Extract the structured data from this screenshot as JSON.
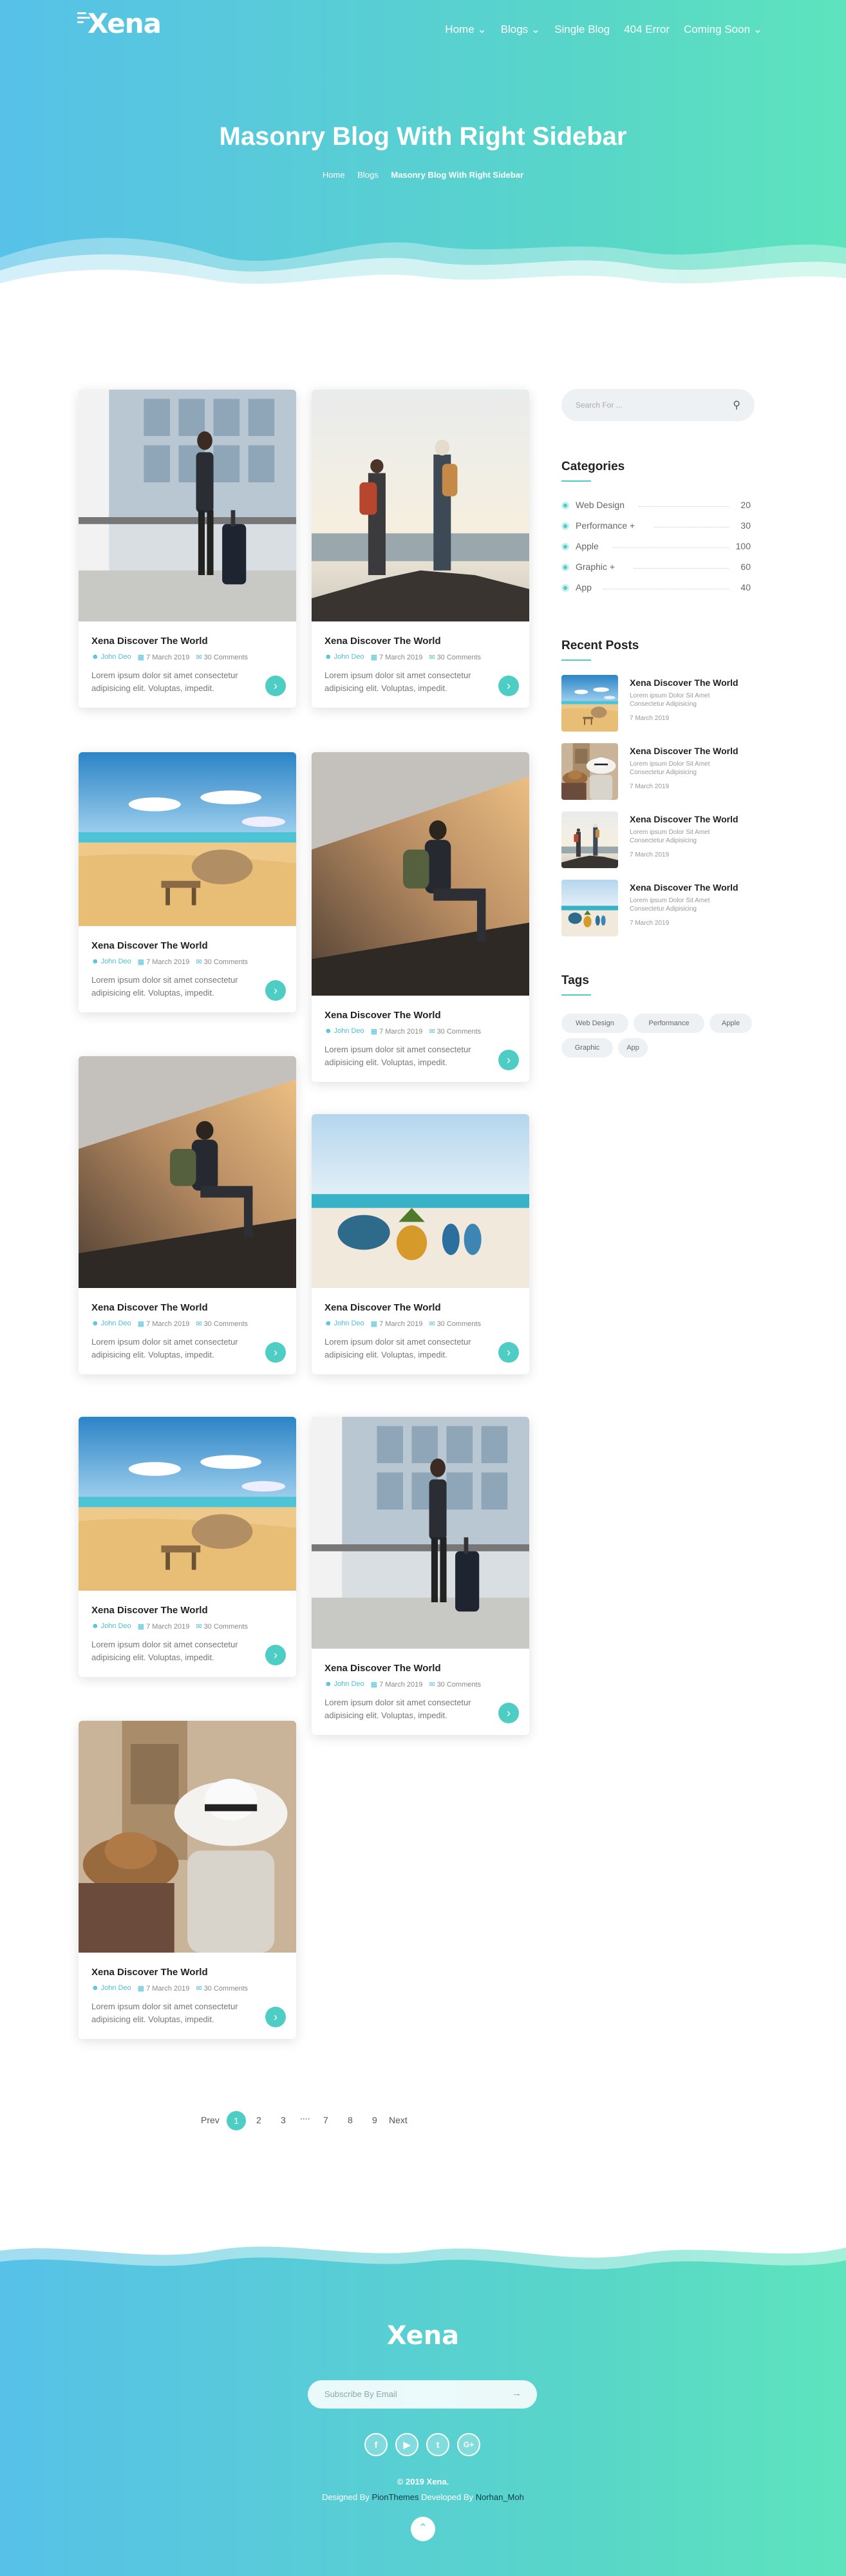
{
  "brand": "Xena",
  "nav": [
    "Home ⌄",
    "Blogs ⌄",
    "Single Blog",
    "404 Error",
    "Coming Soon ⌄"
  ],
  "hero": {
    "title": "Masonry Blog With Right Sidebar",
    "crumbs": [
      "Home",
      "Blogs",
      "Masonry Blog With Right Sidebar"
    ]
  },
  "posts": [
    {
      "title": "Xena Discover The World",
      "author": "John Deo",
      "date": "7 March 2019",
      "comments": "30 Comments",
      "excerpt": "Lorem ipsum dolor sit amet consectetur adipisicing elit. Voluptas, impedit.",
      "img": "city"
    },
    {
      "title": "Xena Discover The World",
      "author": "John Deo",
      "date": "7 March 2019",
      "comments": "30 Comments",
      "excerpt": "Lorem ipsum dolor sit amet consectetur adipisicing elit. Voluptas, impedit.",
      "img": "hikers"
    },
    {
      "title": "Xena Discover The World",
      "author": "John Deo",
      "date": "7 March 2019",
      "comments": "30 Comments",
      "excerpt": "Lorem ipsum dolor sit amet consectetur adipisicing elit. Voluptas, impedit.",
      "img": "beach"
    },
    {
      "title": "Xena Discover The World",
      "author": "John Deo",
      "date": "7 March 2019",
      "comments": "30 Comments",
      "excerpt": "Lorem ipsum dolor sit amet consectetur adipisicing elit. Voluptas, impedit.",
      "img": "rock"
    },
    {
      "title": "Xena Discover The World",
      "author": "John Deo",
      "date": "7 March 2019",
      "comments": "30 Comments",
      "excerpt": "Lorem ipsum dolor sit amet consectetur adipisicing elit. Voluptas, impedit.",
      "img": "rock"
    },
    {
      "title": "Xena Discover The World",
      "author": "John Deo",
      "date": "7 March 2019",
      "comments": "30 Comments",
      "excerpt": "Lorem ipsum dolor sit amet consectetur adipisicing elit. Voluptas, impedit.",
      "img": "sand"
    },
    {
      "title": "Xena Discover The World",
      "author": "John Deo",
      "date": "7 March 2019",
      "comments": "30 Comments",
      "excerpt": "Lorem ipsum dolor sit amet consectetur adipisicing elit. Voluptas, impedit.",
      "img": "beach"
    },
    {
      "title": "Xena Discover The World",
      "author": "John Deo",
      "date": "7 March 2019",
      "comments": "30 Comments",
      "excerpt": "Lorem ipsum dolor sit amet consectetur adipisicing elit. Voluptas, impedit.",
      "img": "city"
    },
    {
      "title": "Xena Discover The World",
      "author": "John Deo",
      "date": "7 March 2019",
      "comments": "30 Comments",
      "excerpt": "Lorem ipsum dolor sit amet consectetur adipisicing elit. Voluptas, impedit.",
      "img": "hats"
    }
  ],
  "sidebar": {
    "search_placeholder": "Search For ...",
    "categories_title": "Categories",
    "categories": [
      {
        "name": "Web Design",
        "count": "20"
      },
      {
        "name": "Performance +",
        "count": "30"
      },
      {
        "name": "Apple",
        "count": "100"
      },
      {
        "name": "Graphic +",
        "count": "60"
      },
      {
        "name": "App",
        "count": "40"
      }
    ],
    "recent_title": "Recent Posts",
    "recent": [
      {
        "title": "Xena Discover The World",
        "excerpt": "Lorem ipsum Dolor Sit Amet Consectetur Adipisicing",
        "date": "7 March 2019",
        "img": "beach"
      },
      {
        "title": "Xena Discover The World",
        "excerpt": "Lorem ipsum Dolor Sit Amet Consectetur Adipisicing",
        "date": "7 March 2019",
        "img": "hats"
      },
      {
        "title": "Xena Discover The World",
        "excerpt": "Lorem ipsum Dolor Sit Amet Consectetur Adipisicing",
        "date": "7 March 2019",
        "img": "hikers"
      },
      {
        "title": "Xena Discover The World",
        "excerpt": "Lorem ipsum Dolor Sit Amet Consectetur Adipisicing",
        "date": "7 March 2019",
        "img": "sand"
      }
    ],
    "tags_title": "Tags",
    "tags": [
      "Web Design",
      "Performance",
      "Apple",
      "Graphic",
      "App"
    ]
  },
  "pagination": {
    "prev": "Prev",
    "pages": [
      "1",
      "2",
      "3",
      "....",
      "7",
      "8",
      "9"
    ],
    "next": "Next",
    "active": "1"
  },
  "footer": {
    "subscribe_placeholder": "Subscribe By Email",
    "social": [
      "f",
      "▶",
      "t",
      "G+"
    ],
    "copyright": "© 2019 Xena.",
    "designed_by": "Designed By",
    "designer": "PionThemes",
    "developed_by": "Developed By",
    "developer": "Norhan_Moh"
  },
  "colors": {
    "accent": "#4ecdc4",
    "gradient_start": "#57c1e8",
    "gradient_end": "#5de4bd"
  }
}
